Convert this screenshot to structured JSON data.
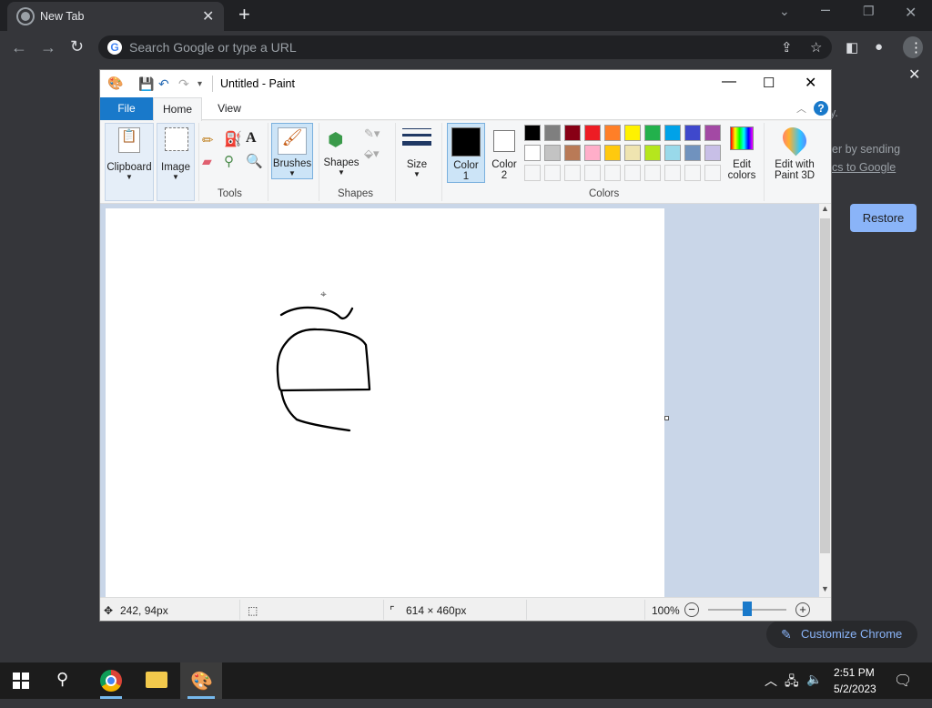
{
  "browser": {
    "tab_title": "New Tab",
    "omnibox_placeholder": "Search Google or type a URL",
    "panel_text_1": "y.",
    "panel_text_2": "er by sending",
    "panel_text_3": "cs to Google",
    "restore_label": "Restore",
    "customize_label": "Customize Chrome"
  },
  "paint": {
    "window_title": "Untitled - Paint",
    "tabs": [
      "File",
      "Home",
      "View"
    ],
    "groups": {
      "clipboard": "Clipboard",
      "image": "Image",
      "tools": "Tools",
      "brushes": "Brushes",
      "shapes_btn": "Shapes",
      "shapes_group": "Shapes",
      "size": "Size",
      "color1": "Color",
      "color1_num": "1",
      "color2": "Color",
      "color2_num": "2",
      "colors": "Colors",
      "edit_colors_1": "Edit",
      "edit_colors_2": "colors",
      "edit3d_1": "Edit with",
      "edit3d_2": "Paint 3D"
    },
    "palette_row1": [
      "#000000",
      "#7f7f7f",
      "#880015",
      "#ed1c24",
      "#ff7f27",
      "#fff200",
      "#22b14c",
      "#00a2e8",
      "#3f48cc",
      "#a349a4"
    ],
    "palette_row2": [
      "#ffffff",
      "#c3c3c3",
      "#b97a57",
      "#ffaec9",
      "#ffc90e",
      "#efe4b0",
      "#b5e61d",
      "#99d9ea",
      "#7092be",
      "#c8bfe7"
    ],
    "color1_value": "#000000",
    "color2_value": "#ffffff",
    "status": {
      "cursor_pos": "242, 94px",
      "canvas_size": "614 × 460px",
      "zoom": "100%",
      "zoom_slider_fraction": 0.5
    }
  },
  "taskbar": {
    "time": "2:51 PM",
    "date": "5/2/2023"
  }
}
